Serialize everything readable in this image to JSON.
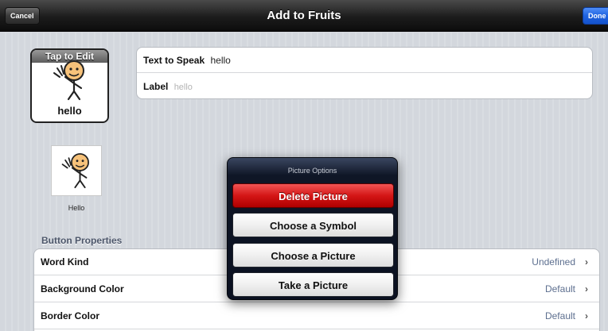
{
  "navbar": {
    "title": "Add to Fruits",
    "cancel_label": "Cancel",
    "done_label": "Done"
  },
  "tile": {
    "edit_label": "Tap to Edit",
    "label": "hello"
  },
  "form": {
    "text_to_speak_label": "Text to Speak",
    "text_to_speak_value": "hello",
    "label_label": "Label",
    "label_placeholder": "hello"
  },
  "symbol": {
    "caption": "Hello"
  },
  "button_properties": {
    "header": "Button Properties",
    "rows": [
      {
        "label": "Word Kind",
        "value": "Undefined"
      },
      {
        "label": "Background Color",
        "value": "Default"
      },
      {
        "label": "Border Color",
        "value": "Default"
      }
    ]
  },
  "popover": {
    "title": "Picture Options",
    "buttons": [
      {
        "label": "Delete Picture"
      },
      {
        "label": "Choose a Symbol"
      },
      {
        "label": "Choose a Picture"
      },
      {
        "label": "Take a Picture"
      }
    ]
  },
  "icons": {
    "tile_symbol": "waving-person-icon",
    "small_symbol": "waving-person-icon",
    "row_chevron": "chevron-right-icon"
  },
  "colors": {
    "navbar": "#1c1c1c",
    "done_button": "#1e62e0",
    "delete_button": "#d41616",
    "popover": "#0f1626",
    "row_value": "#5d6f8f"
  }
}
